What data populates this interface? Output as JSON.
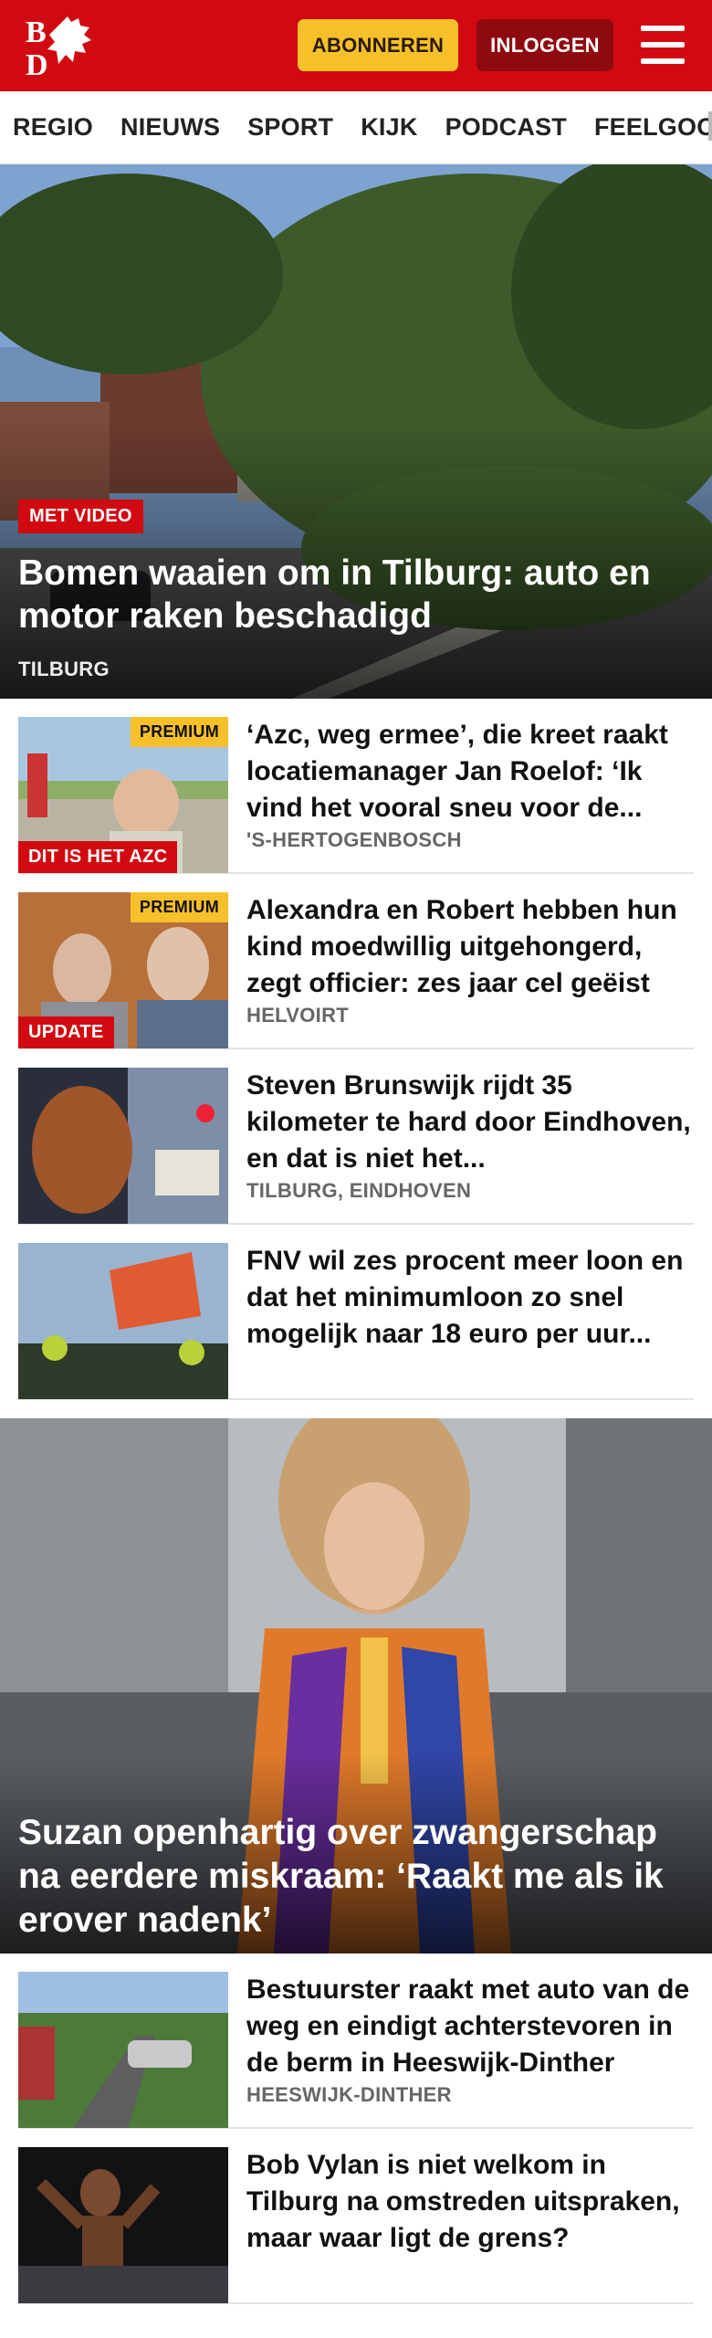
{
  "header": {
    "logo_text": "BD",
    "subscribe_label": "ABONNEREN",
    "login_label": "INLOGGEN",
    "menu_icon": "hamburger-icon",
    "brand_color": "#d10a11",
    "accent_color": "#f6c02b"
  },
  "nav": {
    "items": [
      "REGIO",
      "NIEUWS",
      "SPORT",
      "KIJK",
      "PODCAST",
      "FEELGOOD"
    ]
  },
  "hero": {
    "tag": "MET VIDEO",
    "title": "Bomen waaien om in Tilburg: auto en motor raken beschadigd",
    "location": "TILBURG"
  },
  "articles": [
    {
      "title": "‘Azc, weg ermee’, die kreet raakt locatiemanager Jan Roelof: ‘Ik vind het vooral sneu voor de...",
      "location": "'S-HERTOGENBOSCH",
      "premium": "PREMIUM",
      "tag": "DIT IS HET AZC"
    },
    {
      "title": "Alexandra en Robert hebben hun kind moedwillig uitgehongerd, zegt officier: zes jaar cel geëist",
      "location": "HELVOIRT",
      "premium": "PREMIUM",
      "tag": "UPDATE"
    },
    {
      "title": "Steven Brunswijk rijdt 35 kilometer te hard door Eindhoven, en dat is niet het...",
      "location": "TILBURG, EINDHOVEN"
    },
    {
      "title": "FNV wil zes procent meer loon en dat het minimumloon zo snel mogelijk naar 18 euro per uur...",
      "location": ""
    }
  ],
  "feature": {
    "title": "Suzan openhartig over zwangerschap na eerdere miskraam: ‘Raakt me als ik erover nadenk’"
  },
  "articles2": [
    {
      "title": "Bestuurster raakt met auto van de weg en eindigt achterstevoren in de berm in Heeswijk-Dinther",
      "location": "HEESWIJK-DINTHER"
    },
    {
      "title": "Bob Vylan is niet welkom in Tilburg na omstreden uitspraken, maar waar ligt de grens?",
      "location": ""
    }
  ]
}
